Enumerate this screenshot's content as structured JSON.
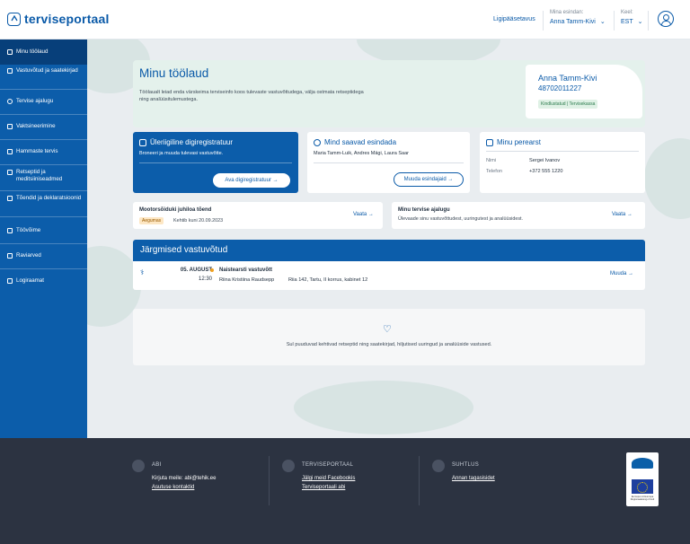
{
  "header": {
    "logo_text": "terviseportaal",
    "accessibility_link": "Ligipääsetavus",
    "representative_label": "Mina esindan:",
    "representative_value": "Anna Tamm-Kivi",
    "language_label": "Keel:",
    "language_value": "EST"
  },
  "sidebar": {
    "items": [
      {
        "label": "Minu töölaud"
      },
      {
        "label": "Vastuvõtud ja saatekirjad"
      },
      {
        "label": "Tervise ajalugu"
      },
      {
        "label": "Vaktsineerimine"
      },
      {
        "label": "Hammaste tervis"
      },
      {
        "label": "Retseptid ja meditsiiniseadmed"
      },
      {
        "label": "Tõendid ja deklaratsioonid"
      },
      {
        "label": "Töövõime"
      },
      {
        "label": "Raviarved"
      },
      {
        "label": "Logiraamat"
      }
    ]
  },
  "welcome": {
    "title": "Minu töölaud",
    "description": "Töölaualt leiad enda värskeima terviseinfo koos tulevaste vastuvõttudega, välja ostmata retseptidega ning analüüsitulemustega.",
    "profile_name": "Anna Tamm-Kivi",
    "profile_code": "48702011227",
    "profile_badge": "Kindlustatud | Tervisekassa"
  },
  "cards": {
    "registry": {
      "title": "Üleriigiline digiregistratuur",
      "subtitle": "Broneeri ja muuda tulevasi vastuvõtte.",
      "button": "Ava digiregistratuur →"
    },
    "representatives": {
      "title": "Mind saavad esindada",
      "names": "Maria Tamm-Luik, Andres Mägi, Laura Saar",
      "button": "Muuda esindajaid →"
    },
    "doctor": {
      "title": "Minu perearst",
      "name_label": "Nimi",
      "name_value": "Sergei Ivanov",
      "phone_label": "Telefon",
      "phone_value": "+372 555 1220"
    }
  },
  "strips": {
    "certificate": {
      "title": "Mootorsõiduki juhiloa tõend",
      "tag": "Aegumas",
      "valid": "Kehtib kuni 20.09.2023",
      "link": "Vaata →"
    },
    "history": {
      "title": "Minu tervise ajalugu",
      "subtitle": "Ülevaade sinu vastuvõttudest, uuringutest ja analüüsidest.",
      "link": "Vaata →"
    }
  },
  "appointments": {
    "title": "Järgmised vastuvõtud",
    "rows": [
      {
        "date": "05. AUGUST",
        "time": "12:30",
        "type": "Naistearsti vastuvõtt",
        "doctor": "Riina Kristiina Raudsepp",
        "location": "Riia 142, Tartu, II korrus, kabinet 12",
        "action": "Muuda →"
      }
    ]
  },
  "empty_state": {
    "text": "Sul puuduvad kehtivad retseptid ning saatekirjad, hiljutised uuringud ja analüüside vastused."
  },
  "footer": {
    "help": {
      "heading": "ABI",
      "email_line": "Kirjuta meile: abi@tehik.ee",
      "contacts_link": "Asutuse kontaktid"
    },
    "portal": {
      "heading": "TERVISEPORTAAL",
      "facebook_link": "Jälgi meid Facebookis",
      "help_link": "Terviseportaali abi"
    },
    "feedback": {
      "heading": "SUHTLUS",
      "feedback_link": "Annan tagasisidet"
    },
    "eu_text": "Euroopa Liit Euroopa Regionaalarengu Fond"
  },
  "colors": {
    "brand_blue": "#0c5daa",
    "footer_bg": "#2c3341",
    "accent_orange": "#f0a020",
    "badge_green": "#dff1e5"
  }
}
